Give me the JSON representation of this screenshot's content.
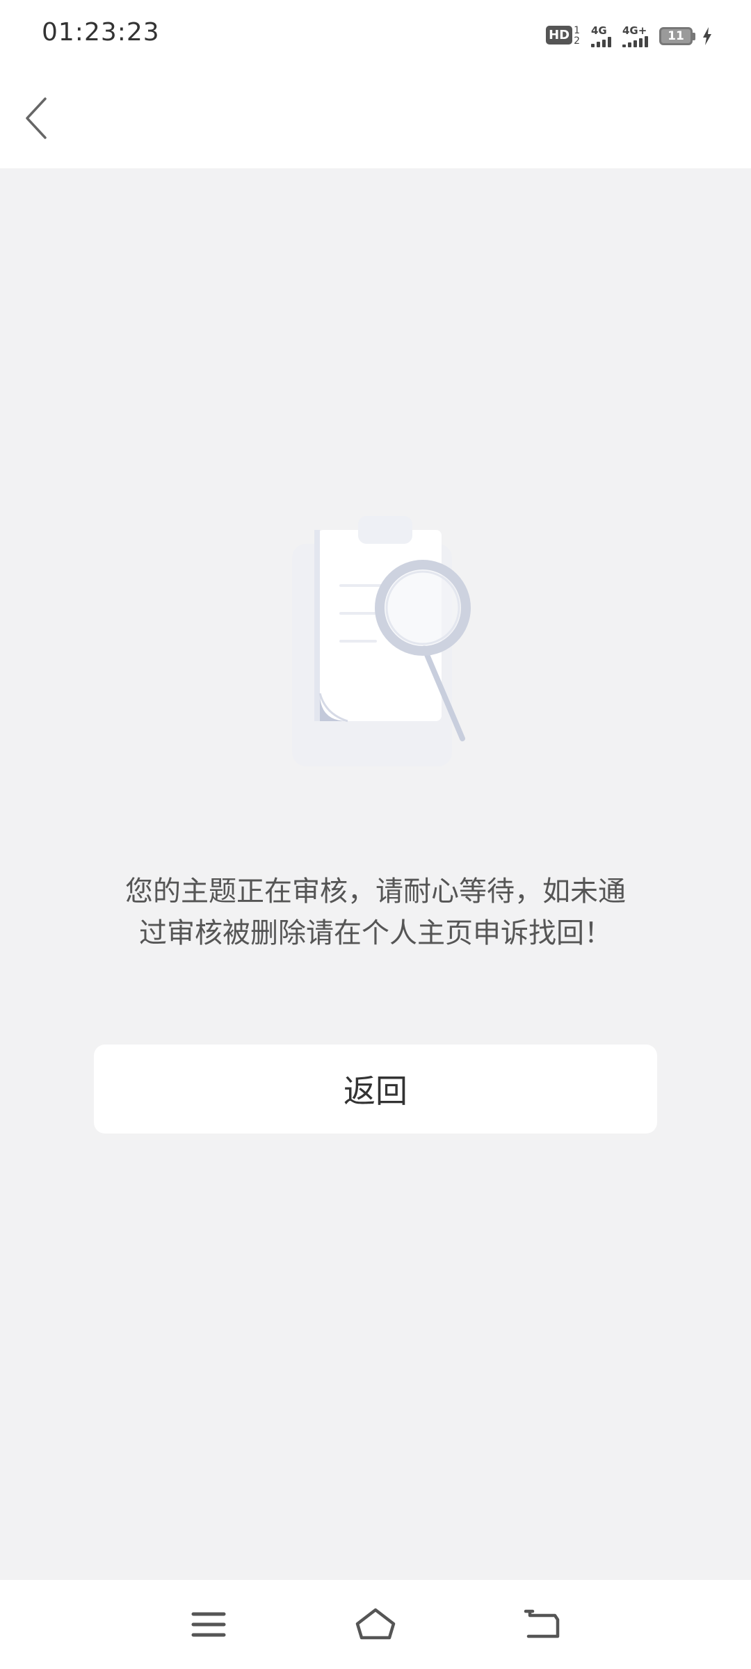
{
  "status_bar": {
    "time": "01:23:23",
    "hd_label": "HD",
    "hd_sim_top": "1",
    "hd_sim_bottom": "2",
    "network_1": "4G",
    "network_2": "4G+",
    "battery_level": "11"
  },
  "header": {
    "back_icon": "chevron-left-icon"
  },
  "main": {
    "illustration_icon": "clipboard-magnifier-icon",
    "message": "您的主题正在审核，请耐心等待，如未通过审核被删除请在个人主页申诉找回！",
    "return_button_label": "返回"
  },
  "system_nav": {
    "menu_icon": "menu-icon",
    "home_icon": "home-icon",
    "back_icon": "back-arrow-icon"
  },
  "colors": {
    "background": "#f2f2f3",
    "surface": "#ffffff",
    "text_primary": "#333333",
    "text_secondary": "#555555",
    "illustration_accent": "#c8cedd"
  }
}
